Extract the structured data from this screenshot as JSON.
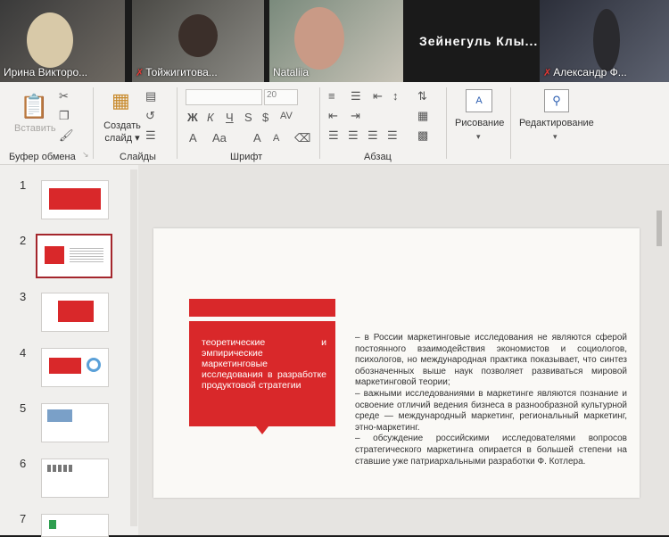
{
  "participants": [
    {
      "name": "Ирина Викторо...",
      "muted": false
    },
    {
      "name": "Тойжигитова...",
      "muted": true
    },
    {
      "name": "Nataliia",
      "muted": false
    },
    {
      "name": "Зейнегуль  Клы...",
      "muted": false
    },
    {
      "name": "Александр Ф...",
      "muted": true
    }
  ],
  "ribbon": {
    "clipboard": {
      "label": "Буфер обмена",
      "paste": "Вставить"
    },
    "slides": {
      "label": "Слайды",
      "create_line1": "Создать",
      "create_line2": "слайд"
    },
    "font": {
      "label": "Шрифт",
      "size": "20",
      "bold": "Ж",
      "italic": "К",
      "underline": "Ч",
      "strike": "S",
      "spacing": "AV",
      "color": "A",
      "case": "Aa",
      "grow": "A",
      "shrink": "A"
    },
    "paragraph": {
      "label": "Абзац"
    },
    "drawing": {
      "label": "Рисование"
    },
    "editing": {
      "label": "Редактирование"
    }
  },
  "thumbnails": [
    {
      "num": "1"
    },
    {
      "num": "2"
    },
    {
      "num": "3"
    },
    {
      "num": "4"
    },
    {
      "num": "5"
    },
    {
      "num": "6"
    },
    {
      "num": "7"
    }
  ],
  "slide": {
    "box_text": "теоретические и эмпирические маркетинговые исследования в разработке продуктовой стратегии",
    "paragraphs": [
      "– в России маркетинговые исследования не являются сферой постоянного взаимодействия экономистов и социологов, психологов, но международная практика показывает, что синтез обозначенных выше наук позволяет развиваться мировой маркетинговой теории;",
      "– важными исследованиями в маркетинге являются познание и освоение отличий ведения бизнеса в разнообразной культурной среде — международный маркетинг, региональный маркетинг, этно-маркетинг.",
      "– обсуждение российскими исследователями вопросов стратегического маркетинга опирается в большей степени на ставшие уже патриархальными разработки Ф. Котлера."
    ]
  },
  "colors": {
    "accent": "#d9282a",
    "selection": "#a4262c"
  }
}
